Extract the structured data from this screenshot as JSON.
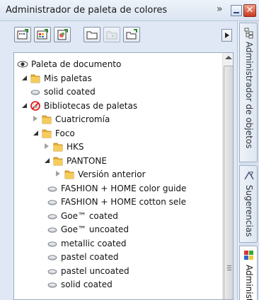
{
  "window": {
    "title": "Administrador de paleta de colores",
    "chevron_glyph": "»",
    "close_glyph": "✕"
  },
  "toolbar": {
    "buttons": [
      {
        "icon": "new-palette-icon",
        "enabled": true
      },
      {
        "icon": "new-palette-from-selection-icon",
        "enabled": true
      },
      {
        "icon": "new-palette-from-document-icon",
        "enabled": true
      },
      {
        "icon": "open-palette-folder-icon",
        "enabled": true
      },
      {
        "icon": "move-palette-icon",
        "enabled": false
      },
      {
        "icon": "new-folder-icon",
        "enabled": true
      }
    ]
  },
  "tree": [
    {
      "label": "Paleta de documento",
      "icon": "eye-icon",
      "toggle": "none"
    },
    {
      "label": "Mis paletas",
      "icon": "folder-icon",
      "toggle": "expanded"
    },
    {
      "label": "solid coated",
      "icon": "palette-icon",
      "toggle": "none"
    },
    {
      "label": "Bibliotecas de paletas",
      "icon": "library-hidden-icon",
      "toggle": "expanded"
    },
    {
      "label": "Cuatricromía",
      "icon": "folder-icon",
      "toggle": "collapsed"
    },
    {
      "label": "Foco",
      "icon": "folder-icon",
      "toggle": "expanded"
    },
    {
      "label": "HKS",
      "icon": "folder-icon",
      "toggle": "collapsed"
    },
    {
      "label": "PANTONE",
      "icon": "folder-icon",
      "toggle": "expanded"
    },
    {
      "label": "Versión anterior",
      "icon": "folder-icon",
      "toggle": "collapsed"
    },
    {
      "label": "FASHION + HOME color guide",
      "icon": "palette-icon",
      "toggle": "none"
    },
    {
      "label": "FASHION + HOME cotton sele",
      "icon": "palette-icon",
      "toggle": "none"
    },
    {
      "label": "Goe™ coated",
      "icon": "palette-icon",
      "toggle": "none"
    },
    {
      "label": "Goe™ uncoated",
      "icon": "palette-icon",
      "toggle": "none"
    },
    {
      "label": "metallic coated",
      "icon": "palette-icon",
      "toggle": "none"
    },
    {
      "label": "pastel coated",
      "icon": "palette-icon",
      "toggle": "none"
    },
    {
      "label": "pastel uncoated",
      "icon": "palette-icon",
      "toggle": "none"
    },
    {
      "label": "solid coated",
      "icon": "palette-icon",
      "toggle": "none"
    }
  ],
  "side_tabs": [
    {
      "label": "Administrador de objetos",
      "icon": "object-manager-icon",
      "active": false
    },
    {
      "label": "Sugerencias",
      "icon": "hints-icon",
      "active": false
    },
    {
      "label": "Administ",
      "icon": "color-palette-manager-icon",
      "active": true
    }
  ],
  "colors": {
    "folder": "#e9b23a",
    "titlebar": "#dae4f1",
    "panel": "#dfe8f4"
  }
}
